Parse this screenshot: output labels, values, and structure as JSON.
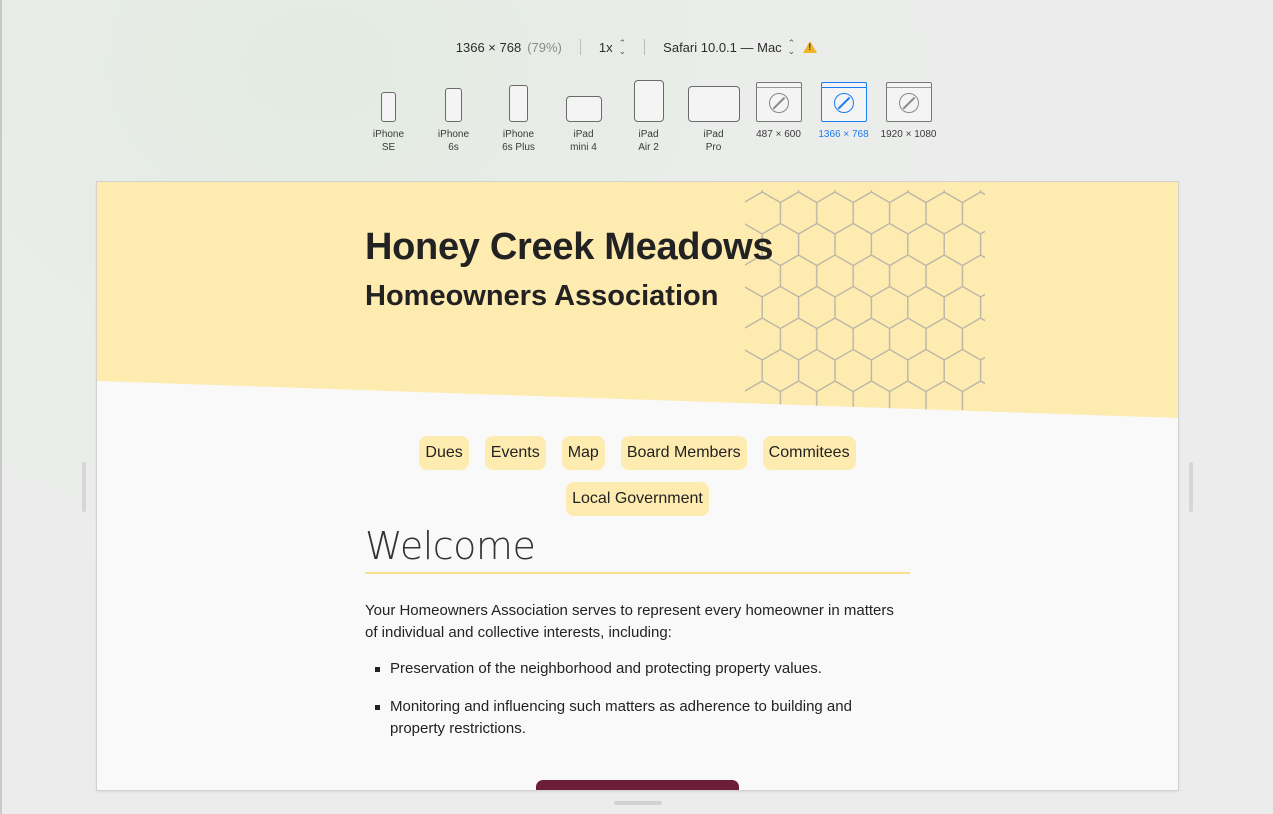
{
  "toolbar": {
    "resolution": "1366 × 768",
    "zoom": "(79%)",
    "scale": "1x",
    "browser": "Safari 10.0.1 — Mac"
  },
  "devices": [
    {
      "label": "iPhone\nSE",
      "icon": "iphone-icon"
    },
    {
      "label": "iPhone\n6s",
      "icon": "iphone-icon"
    },
    {
      "label": "iPhone\n6s Plus",
      "icon": "iphone-icon"
    },
    {
      "label": "iPad\nmini 4",
      "icon": "ipad-icon"
    },
    {
      "label": "iPad\nAir 2",
      "icon": "ipad-icon"
    },
    {
      "label": "iPad\nPro",
      "icon": "ipad-icon"
    },
    {
      "label": "487 × 600",
      "icon": "safari-compass-icon"
    },
    {
      "label": "1366 × 768",
      "icon": "safari-compass-icon",
      "selected": true
    },
    {
      "label": "1920 × 1080",
      "icon": "safari-compass-icon"
    }
  ],
  "site": {
    "title": "Honey Creek Meadows",
    "subtitle": "Homeowners Association",
    "nav": {
      "dues": "Dues",
      "events": "Events",
      "map": "Map",
      "board": "Board Members",
      "committees": "Commitees",
      "local_gov": "Local Government"
    },
    "welcome_heading": "Welcome",
    "intro": "Your Homeowners Association serves to represent every homeowner in matters of individual and collective interests, including:",
    "bullets": [
      "Preservation of the neighborhood and protecting property values.",
      "Monitoring and influencing such matters as adherence to building and property restrictions."
    ]
  },
  "colors": {
    "banner": "#feebb0",
    "accent_line": "#fbe08a",
    "selected": "#1a7cf2",
    "cta": "#6b1d3a"
  }
}
